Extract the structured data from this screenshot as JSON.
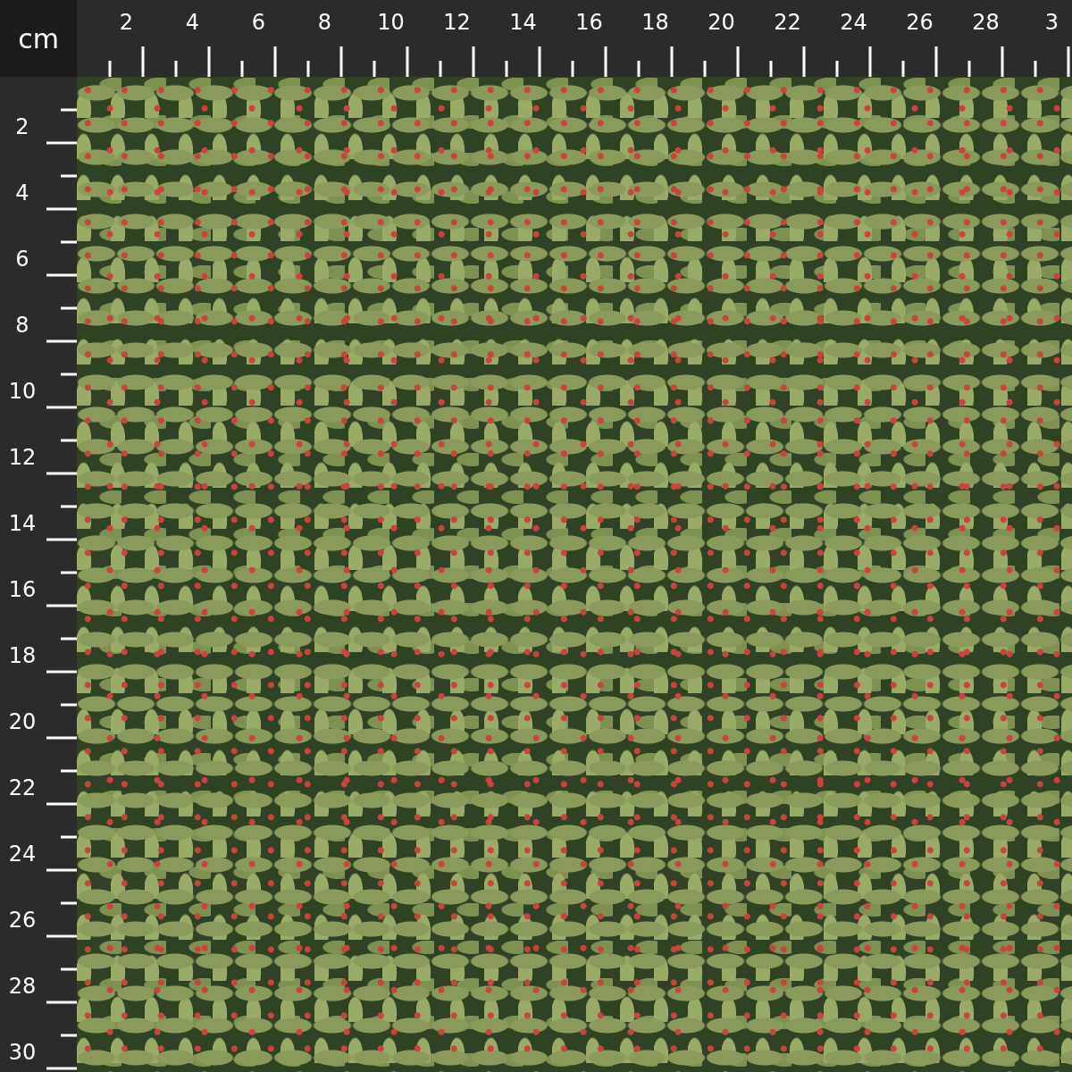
{
  "unit": "cm",
  "top_ruler": {
    "labels": [
      "2",
      "4",
      "6",
      "8",
      "10",
      "12",
      "14",
      "16",
      "18",
      "20",
      "22",
      "24",
      "26",
      "28",
      "3"
    ]
  },
  "left_ruler": {
    "labels": [
      "2",
      "4",
      "6",
      "8",
      "10",
      "12",
      "14",
      "16",
      "18",
      "20",
      "22",
      "24",
      "26",
      "28",
      "30"
    ]
  }
}
